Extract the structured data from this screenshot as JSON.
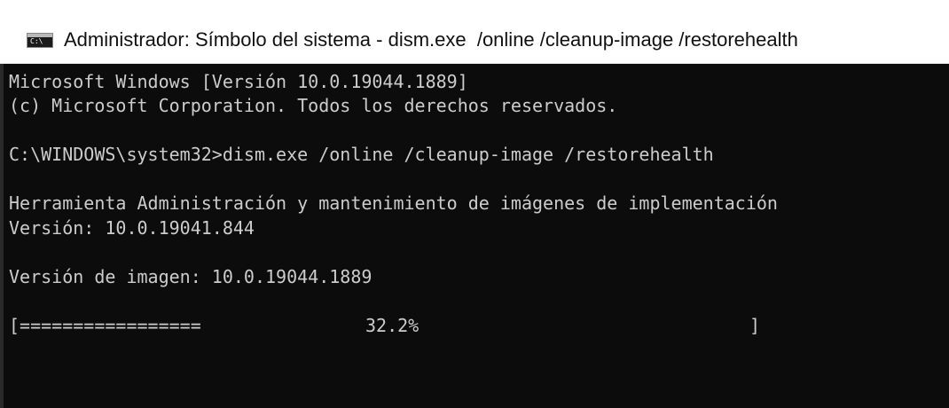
{
  "window": {
    "title": "Administrador: Símbolo del sistema - dism.exe  /online /cleanup-image /restorehealth",
    "icon": "cmd-icon"
  },
  "console": {
    "lines": [
      "Microsoft Windows [Versión 10.0.19044.1889]",
      "(c) Microsoft Corporation. Todos los derechos reservados.",
      "C:\\WINDOWS\\system32>dism.exe /online /cleanup-image /restorehealth",
      "Herramienta Administración y mantenimiento de imágenes de implementación",
      "Versión: 10.0.19041.844",
      "Versión de imagen: 10.0.19044.1889"
    ],
    "progress": {
      "bar_text": "[=================",
      "percent_text": "32.2%",
      "end_bracket": "]",
      "value": 32.2
    }
  },
  "colors": {
    "console_background": "#0c0c0c",
    "console_text": "#cccccc",
    "titlebar_background": "#ffffff"
  }
}
